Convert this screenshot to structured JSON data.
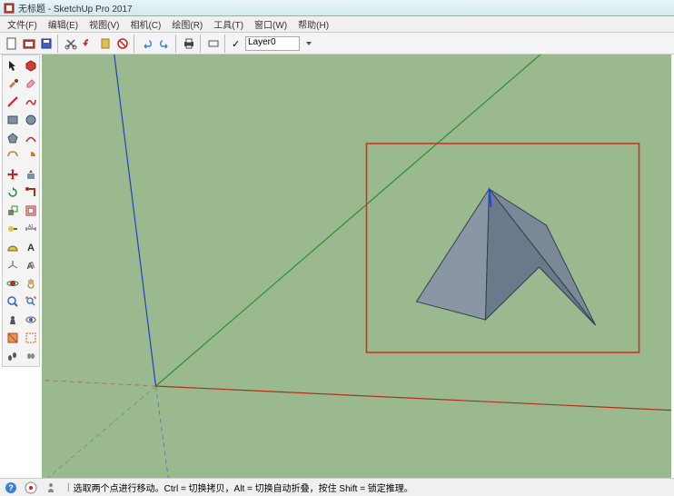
{
  "window": {
    "title": "无标题 - SketchUp Pro 2017"
  },
  "menu": {
    "file": "文件(F)",
    "edit": "编辑(E)",
    "view": "视图(V)",
    "camera": "相机(C)",
    "draw": "绘图(R)",
    "tools": "工具(T)",
    "window": "窗口(W)",
    "help": "帮助(H)"
  },
  "toolbar": {
    "layer_label": "Layer0"
  },
  "status": {
    "hint": "选取两个点进行移动。",
    "mod1": "Ctrl = 切换拷贝，Alt = 切换自动折叠，按住 Shift = 锁定推理。"
  },
  "colors": {
    "bg": "#9bb98f",
    "axis_red": "#b03020",
    "axis_green": "#2a9030",
    "axis_blue": "#2040c0",
    "highlight_box": "#d63020",
    "shape_face": "#6b7a8a",
    "shape_face2": "#8a96a4"
  }
}
